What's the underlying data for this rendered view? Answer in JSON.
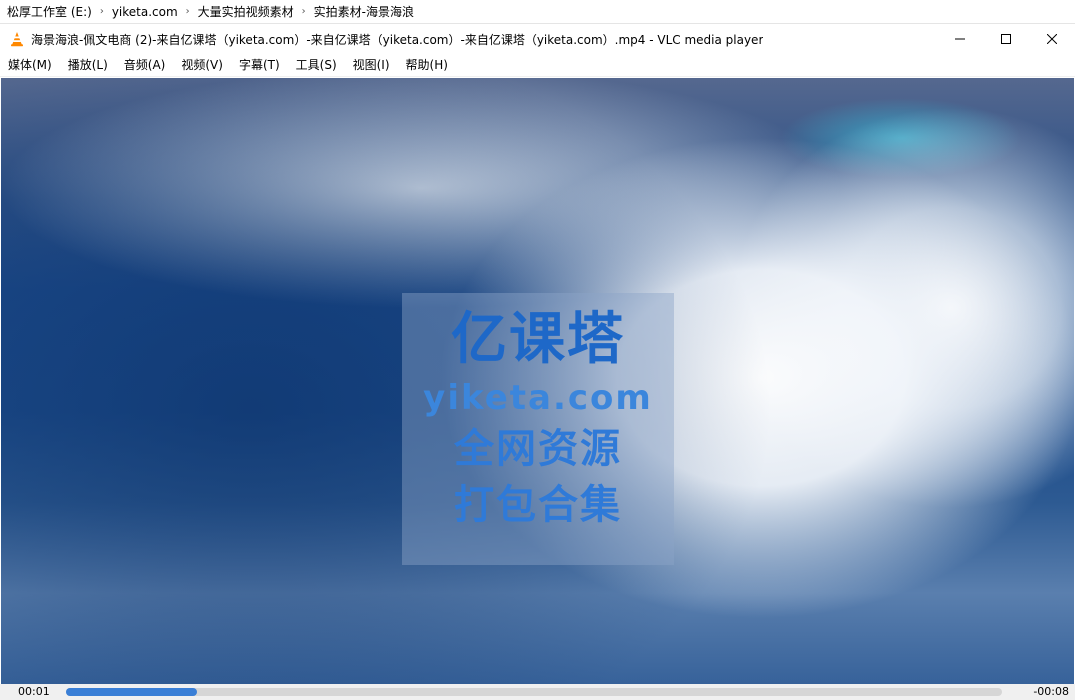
{
  "breadcrumb": {
    "items": [
      "松厚工作室 (E:)",
      "yiketa.com",
      "大量实拍视频素材",
      "实拍素材-海景海浪"
    ],
    "separator": "›"
  },
  "window": {
    "title": "海景海浪-佩文电商 (2)-来自亿课塔（yiketa.com）-来自亿课塔（yiketa.com）-来自亿课塔（yiketa.com）.mp4 - VLC media player",
    "app_icon": "vlc-cone-icon"
  },
  "menu": {
    "items": [
      "媒体(M)",
      "播放(L)",
      "音频(A)",
      "视频(V)",
      "字幕(T)",
      "工具(S)",
      "视图(I)",
      "帮助(H)"
    ]
  },
  "watermark": {
    "line1": "亿课塔",
    "line2": "yiketa.com",
    "line3": "全网资源",
    "line4": "打包合集"
  },
  "status": {
    "elapsed": "00:01",
    "remaining": "-00:08",
    "progress_fraction": 0.14
  },
  "colors": {
    "accent": "#3a7fd6",
    "vlc_orange": "#ff8800"
  }
}
